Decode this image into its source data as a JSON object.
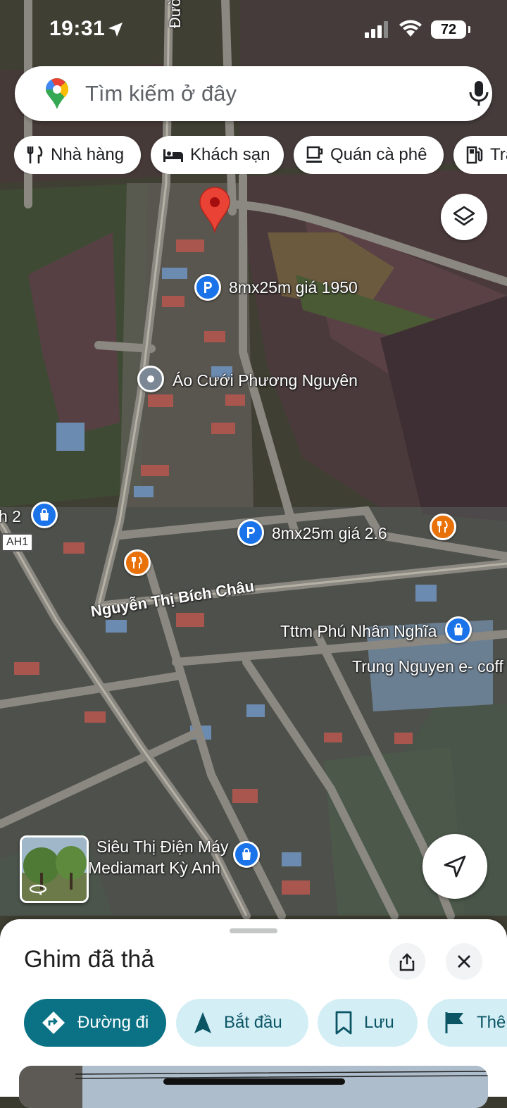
{
  "status_bar": {
    "time": "19:31",
    "battery": "72"
  },
  "search": {
    "placeholder": "Tìm kiếm ở đây"
  },
  "chips": [
    {
      "label": "Nhà hàng",
      "icon": "restaurant-icon"
    },
    {
      "label": "Khách sạn",
      "icon": "hotel-icon"
    },
    {
      "label": "Quán cà phê",
      "icon": "coffee-icon"
    },
    {
      "label": "Trạm xăng",
      "icon": "gas-station-icon"
    }
  ],
  "map": {
    "street_top": "Đường Đ",
    "street_main": "Nguyễn Thị Bích Châu",
    "highway_badge": "AH1",
    "places": [
      {
        "name": "8mx25m giá 1950",
        "type": "parking",
        "color": "#1a73e8"
      },
      {
        "name": "Áo Cưới Phương Nguyên",
        "type": "generic",
        "color": "#7b8794"
      },
      {
        "name": "8mx25m giá 2.6",
        "type": "parking",
        "color": "#1a73e8"
      },
      {
        "name": "h 2",
        "type": "shopping",
        "color": "#1a73e8"
      },
      {
        "name": "Tttm Phú Nhân Nghĩa",
        "type": "shopping",
        "color": "#1a73e8"
      },
      {
        "name": "Trung Nguyen e- coff",
        "type": "text"
      },
      {
        "name": "Siêu Thị Điện Máy",
        "type": "shopping",
        "color": "#1a73e8"
      },
      {
        "name": "Mediamart Kỳ Anh",
        "type": "text"
      }
    ],
    "restaurant_pin_color": "#e8710a",
    "dropped_pin_color": "#ea4335"
  },
  "sheet": {
    "title": "Ghim đã thả",
    "actions": [
      {
        "label": "Đường đi",
        "icon": "directions-icon"
      },
      {
        "label": "Bắt đầu",
        "icon": "navigation-icon"
      },
      {
        "label": "Lưu",
        "icon": "bookmark-icon"
      },
      {
        "label": "Thêm",
        "icon": "flag-icon"
      }
    ]
  }
}
